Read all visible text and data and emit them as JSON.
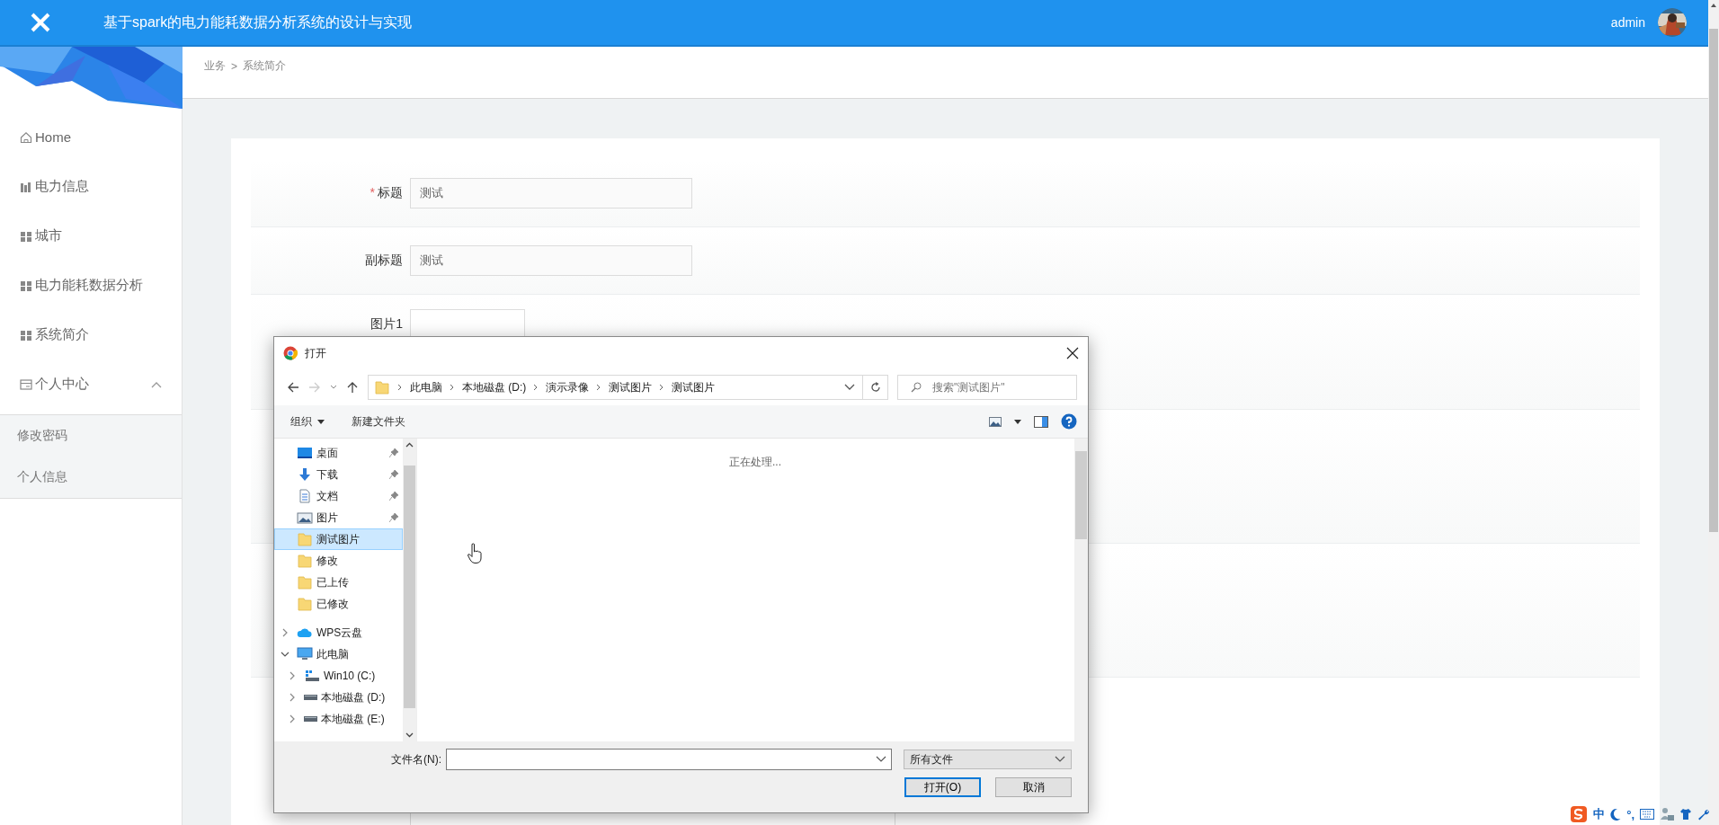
{
  "header": {
    "title": "基于spark的电力能耗数据分析系统的设计与实现",
    "user": "admin"
  },
  "sidebar": {
    "items": [
      {
        "label": "Home"
      },
      {
        "label": "电力信息"
      },
      {
        "label": "城市"
      },
      {
        "label": "电力能耗数据分析"
      },
      {
        "label": "系统简介"
      },
      {
        "label": "个人中心",
        "expanded": true,
        "children": [
          {
            "label": "修改密码"
          },
          {
            "label": "个人信息"
          }
        ]
      }
    ]
  },
  "breadcrumb": {
    "items": [
      "业务",
      "系统简介"
    ],
    "separator": ">"
  },
  "form": {
    "fields": [
      {
        "kind": "text",
        "label": "标题",
        "required_mark": "*",
        "value": "测试"
      },
      {
        "kind": "text",
        "label": "副标题",
        "value": "测试"
      },
      {
        "kind": "upload",
        "label": "图片1"
      },
      {
        "kind": "blank"
      },
      {
        "kind": "blank"
      },
      {
        "kind": "editor"
      }
    ]
  },
  "dialog": {
    "title": "打开",
    "path": [
      "此电脑",
      "本地磁盘 (D:)",
      "演示录像",
      "测试图片",
      "测试图片"
    ],
    "search": {
      "placeholder": "搜索\"测试图片\""
    },
    "toolbar": {
      "organize": "组织",
      "new_folder": "新建文件夹"
    },
    "nav": [
      {
        "kind": "quick",
        "label": "桌面",
        "pinned": true,
        "selected": false
      },
      {
        "kind": "quick",
        "label": "下载",
        "pinned": true,
        "selected": false
      },
      {
        "kind": "quick",
        "label": "文档",
        "pinned": true,
        "selected": false
      },
      {
        "kind": "quick",
        "label": "图片",
        "pinned": true,
        "selected": false
      },
      {
        "kind": "quick",
        "label": "测试图片",
        "pinned": false,
        "selected": true
      },
      {
        "kind": "quick",
        "label": "修改",
        "pinned": false,
        "selected": false
      },
      {
        "kind": "quick",
        "label": "已上传",
        "pinned": false,
        "selected": false
      },
      {
        "kind": "quick",
        "label": "已修改",
        "pinned": false,
        "selected": false
      },
      {
        "kind": "node",
        "label": "WPS云盘",
        "expanded": false,
        "selected": false
      },
      {
        "kind": "node",
        "label": "此电脑",
        "expanded": true,
        "selected": false,
        "children": [
          {
            "kind": "node",
            "label": "Win10 (C:)",
            "expanded": false,
            "selected": false
          },
          {
            "kind": "node",
            "label": "本地磁盘 (D:)",
            "expanded": false,
            "selected": false
          },
          {
            "kind": "node",
            "label": "本地磁盘 (E:)",
            "expanded": false,
            "selected": false
          }
        ]
      }
    ],
    "status": "正在处理...",
    "filename_label": "文件名(N):",
    "filter": "所有文件",
    "buttons": [
      {
        "label": "打开(O)",
        "default": true
      },
      {
        "label": "取消",
        "default": false
      }
    ]
  },
  "tray": {
    "ime": "中",
    "punctuation": "°,"
  }
}
